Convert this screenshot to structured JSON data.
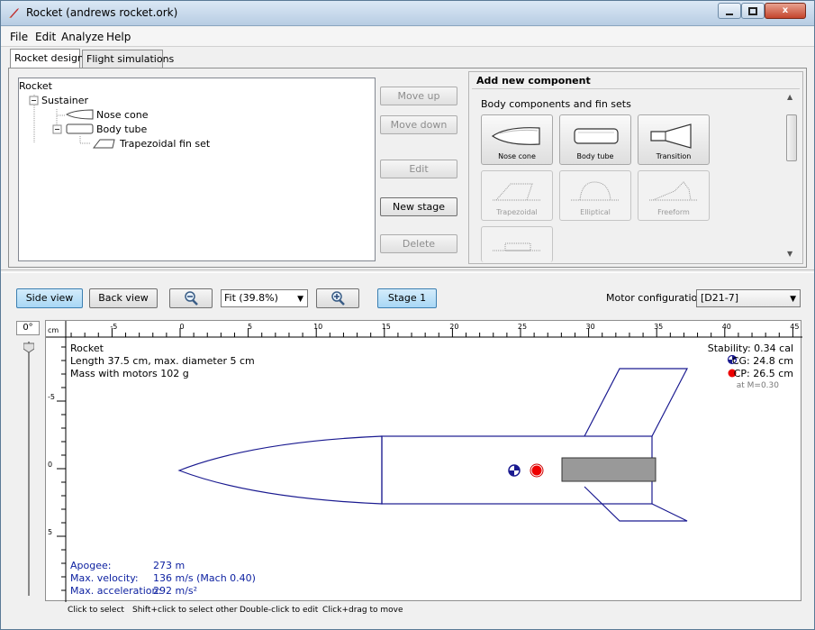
{
  "window": {
    "title": "Rocket (andrews rocket.ork)",
    "close_label": "x"
  },
  "menu": [
    "File",
    "Edit",
    "Analyze",
    "Help"
  ],
  "tabs": [
    "Rocket design",
    "Flight simulations"
  ],
  "tree": {
    "root": "Rocket",
    "stage": "Sustainer",
    "nose": "Nose cone",
    "body": "Body tube",
    "fin": "Trapezoidal fin set"
  },
  "side_buttons": {
    "move_up": "Move up",
    "move_down": "Move down",
    "edit": "Edit",
    "new_stage": "New stage",
    "delete": "Delete"
  },
  "add_component": {
    "title": "Add new component",
    "section": "Body components and fin sets",
    "items": [
      "Nose cone",
      "Body tube",
      "Transition",
      "Trapezoidal",
      "Elliptical",
      "Freeform"
    ]
  },
  "toolbar": {
    "side_view": "Side view",
    "back_view": "Back view",
    "zoom": "Fit (39.8%)",
    "stage": "Stage 1",
    "motor_label": "Motor configuration:",
    "motor_value": "[D21-7]"
  },
  "view": {
    "angle": "0°",
    "ruler_unit": "cm",
    "x_ticks": [
      "-5",
      "0",
      "5",
      "10",
      "15",
      "20",
      "25",
      "30",
      "35",
      "40",
      "45"
    ],
    "y_ticks": [
      "-5",
      "0",
      "5"
    ],
    "rocket_name": "Rocket",
    "length_line": "Length 37.5 cm, max. diameter 5 cm",
    "mass_line": "Mass with motors 102 g",
    "stability": "Stability: 0.34 cal",
    "cg": "CG: 24.8 cm",
    "cp": "CP: 26.5 cm",
    "mach": "at M=0.30",
    "apogee_label": "Apogee:",
    "apogee_value": "273 m",
    "velocity_label": "Max. velocity:",
    "velocity_value": "136 m/s  (Mach 0.40)",
    "accel_label": "Max. acceleration:",
    "accel_value": "292 m/s²"
  },
  "status": [
    "Click to select",
    "Shift+click to select other",
    "Double-click to edit",
    "Click+drag to move"
  ]
}
